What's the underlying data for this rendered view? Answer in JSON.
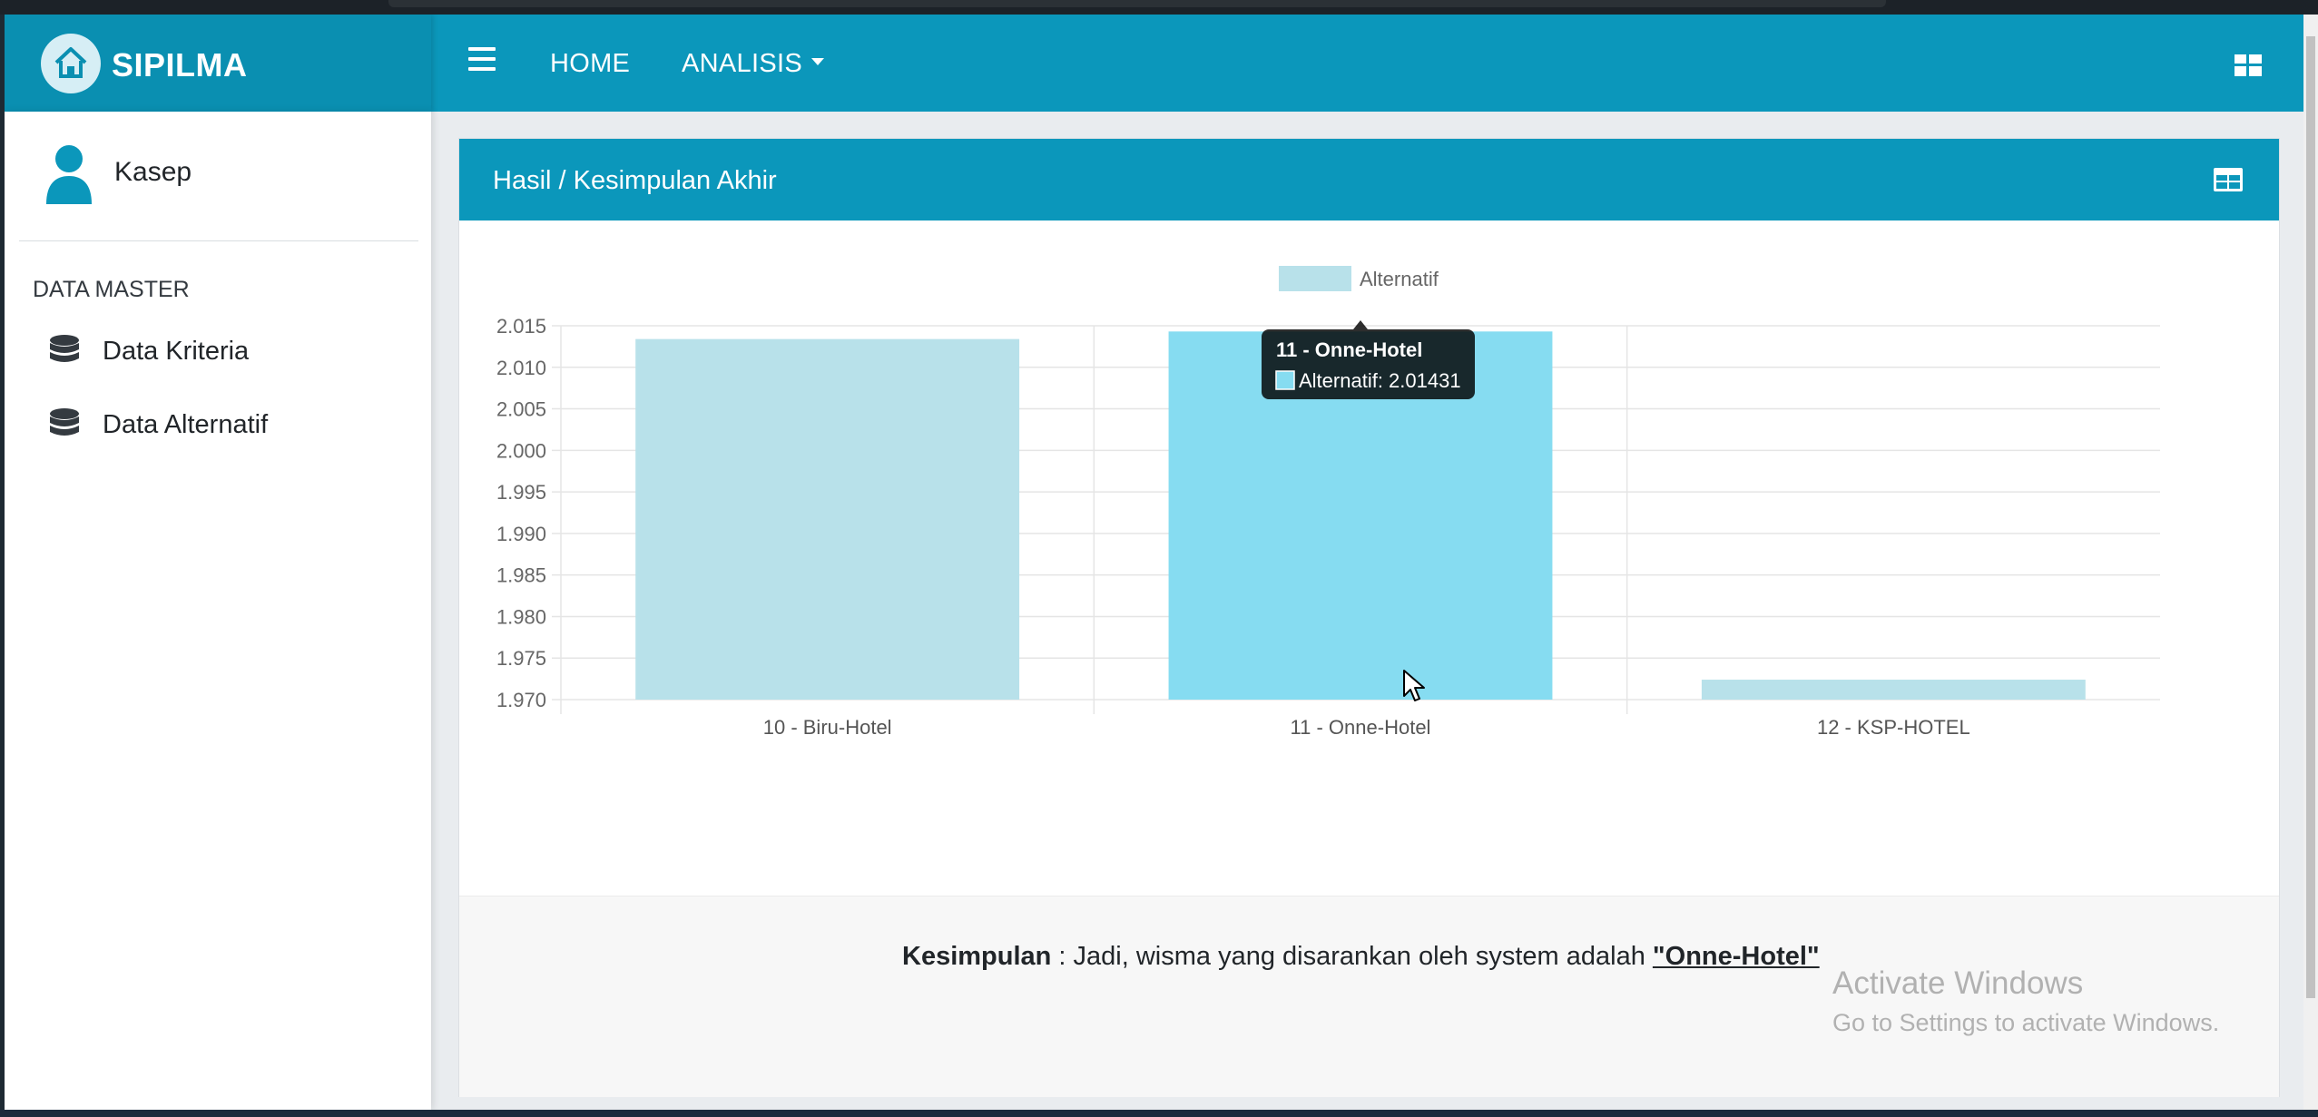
{
  "app": {
    "brand": "SIPILMA"
  },
  "nav": {
    "home": "HOME",
    "analisis": "ANALISIS"
  },
  "sidebar": {
    "user": "Kasep",
    "heading": "DATA MASTER",
    "items": [
      {
        "label": "Data Kriteria",
        "icon": "database-icon"
      },
      {
        "label": "Data Alternatif",
        "icon": "database-icon"
      }
    ]
  },
  "card": {
    "title": "Hasil / Kesimpulan Akhir",
    "conclusion": {
      "label": "Kesimpulan",
      "text": " : Jadi, wisma yang disarankan oleh system adalah ",
      "result": "\"Onne-Hotel\""
    }
  },
  "chart_data": {
    "type": "bar",
    "categories": [
      "10 - Biru-Hotel",
      "11 - Onne-Hotel",
      "12 - KSP-HOTEL"
    ],
    "series": [
      {
        "name": "Alternatif",
        "values": [
          2.0134,
          2.01431,
          1.9724
        ]
      }
    ],
    "ylim": [
      1.97,
      2.015
    ],
    "yticks": [
      "1.970",
      "1.975",
      "1.980",
      "1.985",
      "1.990",
      "1.995",
      "2.000",
      "2.005",
      "2.010",
      "2.015"
    ],
    "legend": "top-center",
    "grid": true,
    "tooltip": {
      "title": "11 - Onne-Hotel",
      "body": "Alternatif: 2.01431"
    },
    "colors": {
      "bar": "#b8e1ea",
      "bar_hover": "#86dcf1"
    }
  },
  "colors": {
    "primary": "#0b97bb",
    "primary_dark": "#0a8fb1"
  },
  "watermark": {
    "line1": "Activate Windows",
    "line2": "Go to Settings to activate Windows."
  }
}
